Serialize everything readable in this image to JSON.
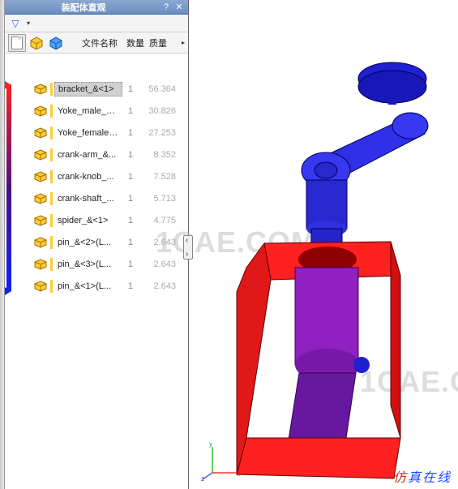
{
  "panel": {
    "title": "装配体直观",
    "help_glyph": "?",
    "close_glyph": "✕",
    "filter_glyph": "▽",
    "dropdown_glyph": "▾"
  },
  "columns": {
    "filename": "文件名称",
    "qty": "数量",
    "mass": "质量",
    "expand": "▸"
  },
  "tree": [
    {
      "name": "bracket_&<1>",
      "qty": "1",
      "mass": "56.364",
      "selected": true
    },
    {
      "name": "Yoke_male_&...",
      "qty": "1",
      "mass": "30.826",
      "selected": false
    },
    {
      "name": "Yoke_female_...",
      "qty": "1",
      "mass": "27.253",
      "selected": false
    },
    {
      "name": "crank-arm_&...",
      "qty": "1",
      "mass": "8.352",
      "selected": false
    },
    {
      "name": "crank-knob_...",
      "qty": "1",
      "mass": "7.528",
      "selected": false
    },
    {
      "name": "crank-shaft_...",
      "qty": "1",
      "mass": "5.713",
      "selected": false
    },
    {
      "name": "spider_&<1>",
      "qty": "1",
      "mass": "4.775",
      "selected": false
    },
    {
      "name": "pin_&<2>(L...",
      "qty": "1",
      "mass": "2.643",
      "selected": false
    },
    {
      "name": "pin_&<3>(L...",
      "qty": "1",
      "mass": "2.643",
      "selected": false
    },
    {
      "name": "pin_&<1>(L...",
      "qty": "1",
      "mass": "2.643",
      "selected": false
    }
  ],
  "watermark": "1CAE.COM",
  "footer": {
    "a": "仿",
    "b": "真",
    "c": "在",
    "d": "线"
  },
  "triad": {
    "x": "x",
    "y": "y",
    "z": "z"
  }
}
